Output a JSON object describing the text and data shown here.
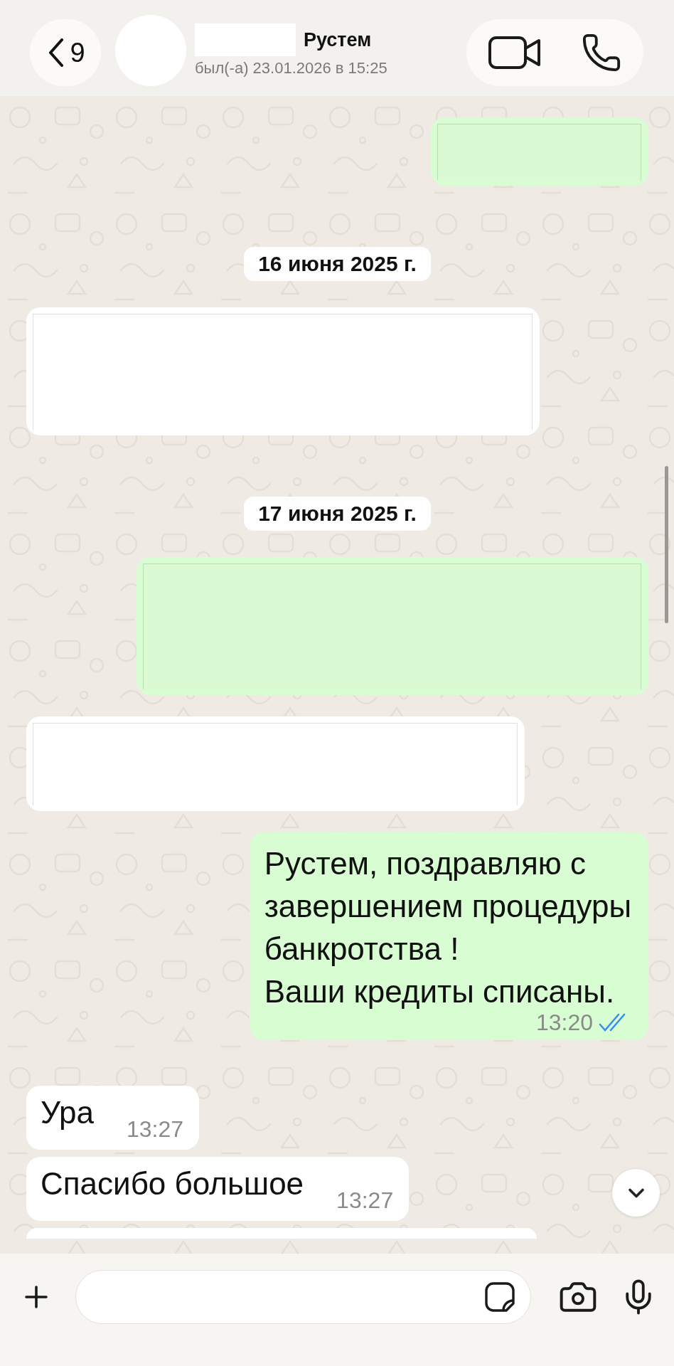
{
  "header": {
    "back_count": "9",
    "contact_name": "Рустем",
    "status": "был(-а) 23.01.2026 в 15:25"
  },
  "messages": [
    {
      "kind": "redacted",
      "outgoing": true
    },
    {
      "kind": "date",
      "text": "16 июня 2025 г."
    },
    {
      "kind": "redacted",
      "outgoing": false
    },
    {
      "kind": "date",
      "text": "17 июня 2025 г."
    },
    {
      "kind": "redacted",
      "outgoing": true
    },
    {
      "kind": "redacted",
      "outgoing": false
    },
    {
      "kind": "text",
      "outgoing": true,
      "text": "Рустем, поздравляю с\nзавершением процедуры\nбанкротства !\nВаши кредиты списаны.",
      "time": "13:20",
      "read": true
    },
    {
      "kind": "text",
      "outgoing": false,
      "text": "Ура",
      "time": "13:27"
    },
    {
      "kind": "text",
      "outgoing": false,
      "text": "Спасибо большое",
      "time": "13:27"
    },
    {
      "kind": "cut_off",
      "outgoing": false
    }
  ]
}
